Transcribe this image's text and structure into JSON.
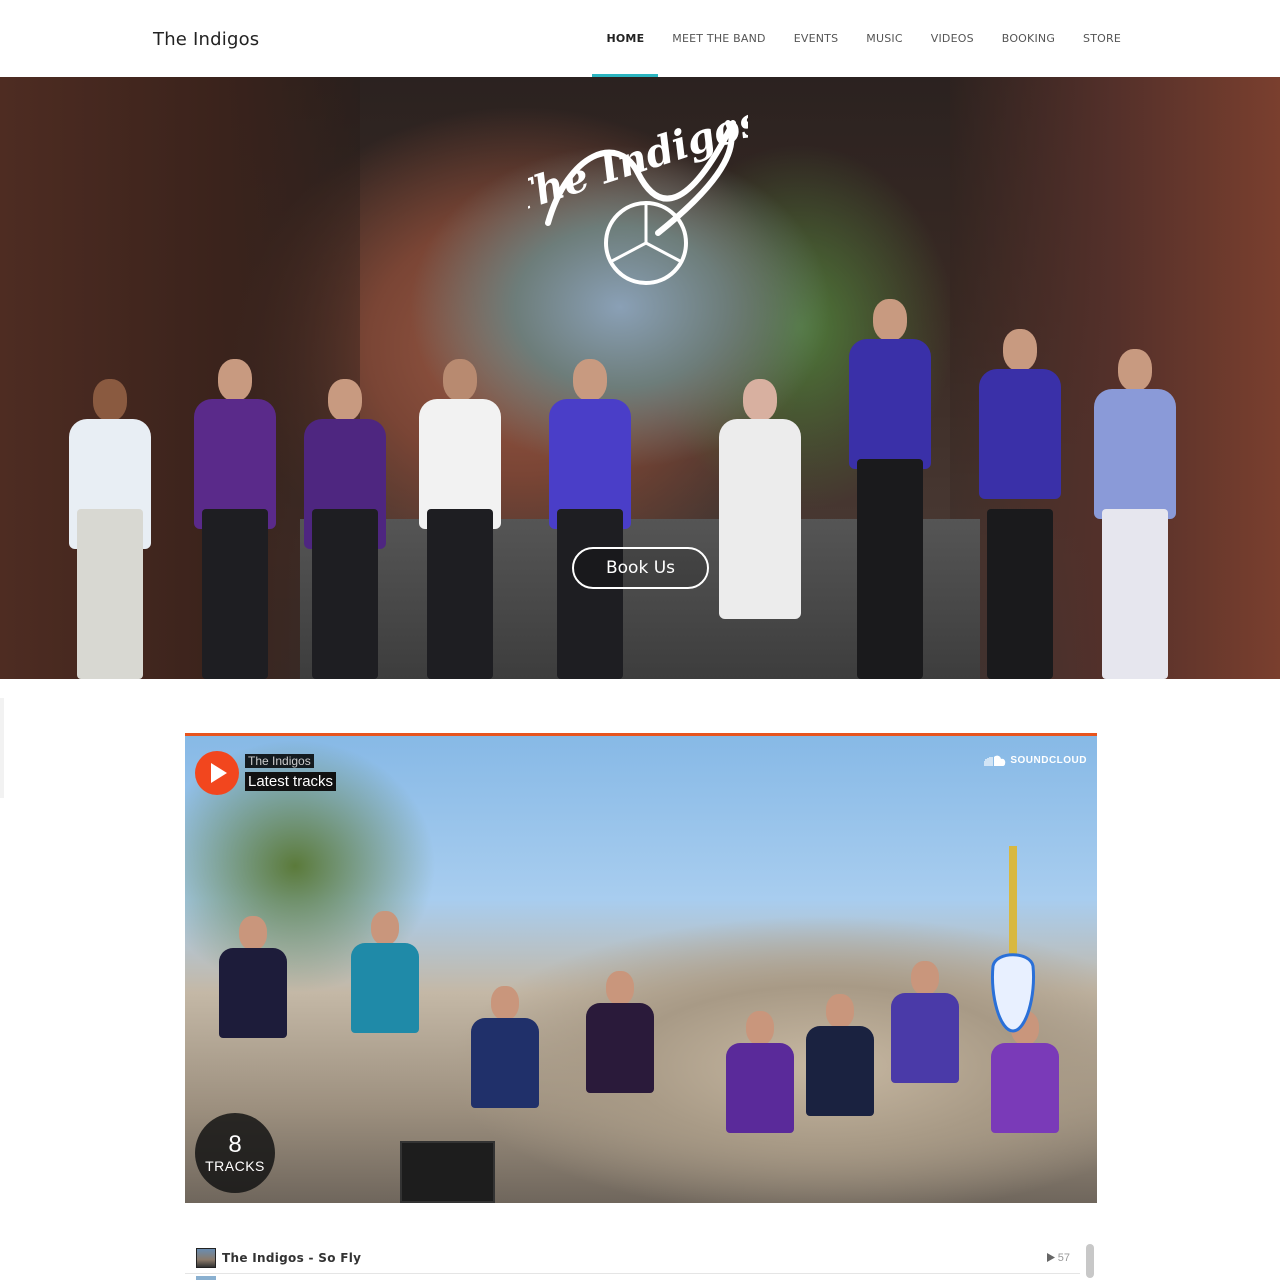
{
  "header": {
    "site_title": "The Indigos",
    "nav": [
      {
        "label": "HOME",
        "active": true
      },
      {
        "label": "MEET THE BAND",
        "active": false
      },
      {
        "label": "EVENTS",
        "active": false
      },
      {
        "label": "MUSIC",
        "active": false
      },
      {
        "label": "VIDEOS",
        "active": false
      },
      {
        "label": "BOOKING",
        "active": false
      },
      {
        "label": "STORE",
        "active": false
      }
    ]
  },
  "hero": {
    "logo_text": "The Indigos",
    "cta_label": "Book Us"
  },
  "player": {
    "artist": "The Indigos",
    "title": "Latest tracks",
    "brand": "SOUNDCLOUD",
    "track_count": "8",
    "track_count_label": "TRACKS",
    "tracks": [
      {
        "name": "The Indigos - So Fly",
        "plays": "57"
      }
    ]
  },
  "colors": {
    "nav_accent": "#2bb5c0",
    "soundcloud_orange": "#f2461e"
  }
}
